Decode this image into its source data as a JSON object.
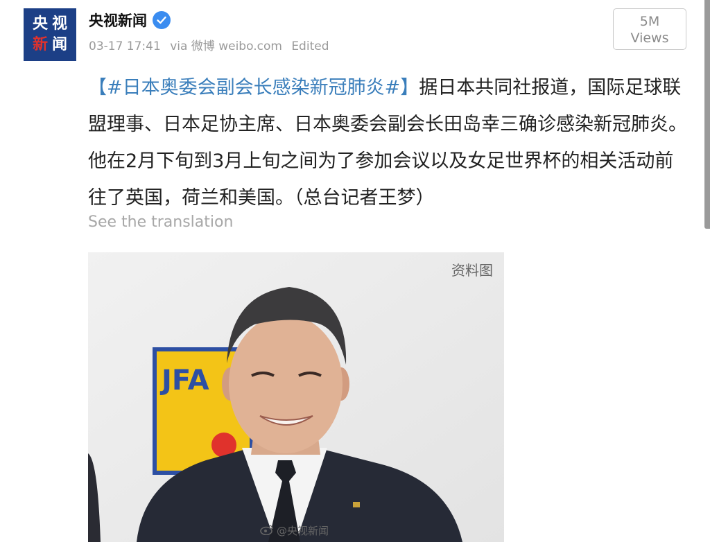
{
  "post": {
    "account_name": "央视新闻",
    "avatar_chars": [
      "央",
      "视",
      "新",
      "闻"
    ],
    "date": "03-17 17:41",
    "via": "via 微博 weibo.com",
    "edited": "Edited",
    "views_count": "5M",
    "views_label": "Views",
    "hashtag": "【#日本奥委会副会长感染新冠肺炎#】",
    "body": "据日本共同社报道，国际足球联盟理事、日本足协主席、日本奥委会副会长田岛幸三确诊感染新冠肺炎。他在2月下旬到3月上旬之间为了参加会议以及女足世界杯的相关活动前往了英国，荷兰和美国。（总台记者王梦）",
    "translation_link": "See the translation"
  },
  "image": {
    "label": "资料图",
    "logo_text": "JFA",
    "watermark": "@央视新闻"
  },
  "colors": {
    "hashtag": "#3a7ebb",
    "verified": "#3a8cf0",
    "avatar_bg": "#1c3f86"
  }
}
